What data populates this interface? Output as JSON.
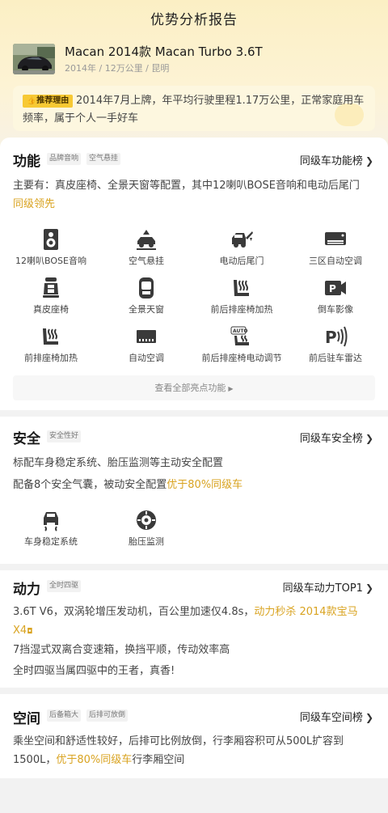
{
  "page_title": "优势分析报告",
  "car": {
    "name": "Macan 2014款 Macan Turbo 3.6T",
    "meta": "2014年 / 12万公里 / 昆明"
  },
  "reason": {
    "badge": "推荐理由",
    "text": "2014年7月上牌，年平均行驶里程1.17万公里，正常家庭用车频率，属于个人一手好车"
  },
  "function": {
    "title": "功能",
    "tags": [
      "品牌音响",
      "空气悬挂"
    ],
    "rank_link": "同级车功能榜",
    "desc": "主要有：真皮座椅、全景天窗等配置，其中12喇叭BOSE音响和电动后尾门",
    "desc_highlight": "同级领先",
    "items": [
      {
        "label": "12喇叭BOSE音响",
        "icon": "speaker-icon"
      },
      {
        "label": "空气悬挂",
        "icon": "air-suspension-icon"
      },
      {
        "label": "电动后尾门",
        "icon": "power-tailgate-icon"
      },
      {
        "label": "三区自动空调",
        "icon": "ac-unit-icon"
      },
      {
        "label": "真皮座椅",
        "icon": "leather-seat-icon"
      },
      {
        "label": "全景天窗",
        "icon": "sunroof-icon"
      },
      {
        "label": "前后排座椅加热",
        "icon": "seat-heat-icon"
      },
      {
        "label": "倒车影像",
        "icon": "reverse-camera-icon"
      },
      {
        "label": "前排座椅加热",
        "icon": "front-seat-heat-icon"
      },
      {
        "label": "自动空调",
        "icon": "auto-ac-icon"
      },
      {
        "label": "前后排座椅电动调节",
        "icon": "seat-auto-icon"
      },
      {
        "label": "前后驻车雷达",
        "icon": "parking-radar-icon"
      }
    ],
    "more_label": "查看全部亮点功能"
  },
  "safety": {
    "title": "安全",
    "tags": [
      "安全性好"
    ],
    "rank_link": "同级车安全榜",
    "line1": "标配车身稳定系统、胎压监测等主动安全配置",
    "line2": "配备8个安全气囊，被动安全配置",
    "line2_highlight": "优于80%同级车",
    "items": [
      {
        "label": "车身稳定系统",
        "icon": "esp-icon"
      },
      {
        "label": "胎压监测",
        "icon": "tire-pressure-icon"
      }
    ]
  },
  "power": {
    "title": "动力",
    "tags": [
      "全时四驱"
    ],
    "rank_link": "同级车动力TOP1",
    "line1": "3.6T V6，双涡轮增压发动机，百公里加速仅4.8s，",
    "line1_highlight": "动力秒杀 2014款宝马X4",
    "line2": "7挡湿式双离合变速箱，换挡平顺，传动效率高",
    "line3": "全时四驱当属四驱中的王者，真香!"
  },
  "space": {
    "title": "空间",
    "tags": [
      "后备箱大",
      "后排可放倒"
    ],
    "rank_link": "同级车空间榜",
    "line1": "乘坐空间和舒适性较好，后排可比例放倒，行李厢容积可从500L扩容到1500L，",
    "line1_highlight": "优于80%同级车",
    "line1_tail": "行李厢空间"
  },
  "colors": {
    "accent": "#d9a320",
    "badge": "#f7c934",
    "hero_bg": "#fbefc4"
  }
}
